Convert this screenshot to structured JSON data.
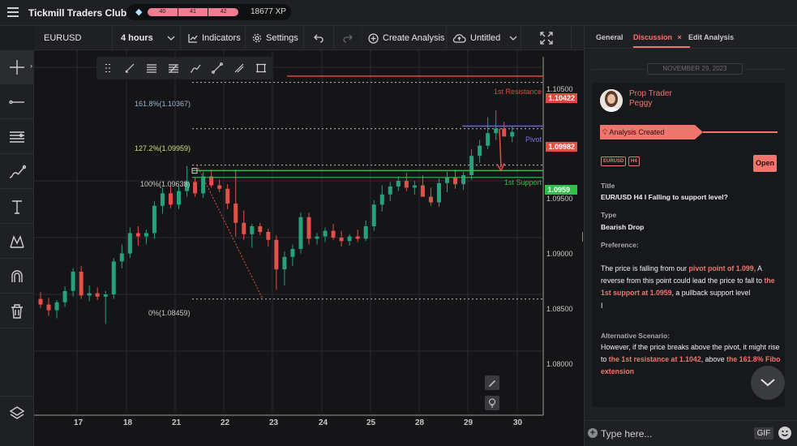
{
  "app": {
    "title": "Tickmill Traders Club",
    "xp_segments": [
      "40",
      "41",
      "42"
    ],
    "xp": "18677 XP"
  },
  "toolbar": {
    "symbol": "EURUSD",
    "timeframe": "4 hours",
    "indicators": "Indicators",
    "settings": "Settings",
    "create_analysis": "Create Analysis",
    "layout": "Untitled"
  },
  "left_tools": [
    "crosshair-icon",
    "horizontal-line-icon",
    "channel-icon",
    "brush-icon",
    "text-icon",
    "pattern-icon",
    "magnet-icon",
    "trash-icon",
    "layers-icon"
  ],
  "draw_tools": [
    "drag-handle-icon",
    "pencil-icon",
    "lines-icon",
    "fib-icon",
    "brush-icon",
    "ray-icon",
    "eraser-icon",
    "rectangle-icon"
  ],
  "chart_data": {
    "type": "candlestick",
    "symbol": "EURUSD",
    "timeframe": "4 hours",
    "y_ticks": [
      "1.10500",
      "1.09500",
      "1.09000",
      "1.08500",
      "1.08000"
    ],
    "x_ticks": [
      "17",
      "18",
      "21",
      "22",
      "23",
      "24",
      "25",
      "28",
      "29",
      "30"
    ],
    "ylim": [
      1.0765,
      1.1065
    ],
    "levels": [
      {
        "label": "1st Resistance",
        "value": 1.10422,
        "tag": "1.10422",
        "color": "#e2473f"
      },
      {
        "label": "Pivot",
        "value": 1.09982,
        "tag": "1.09982",
        "color": "#6b63d6"
      },
      {
        "label": "1st Support",
        "value": 1.0959,
        "tag": "1.0959",
        "color": "#2fbf4a"
      }
    ],
    "fib": [
      {
        "label": "161.8%(1.10367)",
        "value": 1.10367,
        "color": "#9ab4d4"
      },
      {
        "label": "127.2%(1.09959)",
        "value": 1.09959,
        "color": "#cfe07a"
      },
      {
        "label": "100%(1.09638)",
        "value": 1.09638,
        "color": "#c9c9c9"
      },
      {
        "label": "0%(1.08459)",
        "value": 1.08459,
        "color": "#c9c9c9"
      }
    ],
    "candles": [
      [
        1.0846,
        1.0852,
        1.0838,
        1.0841
      ],
      [
        1.0841,
        1.0847,
        1.0831,
        1.0836
      ],
      [
        1.0836,
        1.0845,
        1.0829,
        1.0843
      ],
      [
        1.0843,
        1.0857,
        1.0839,
        1.0853
      ],
      [
        1.0853,
        1.0873,
        1.0848,
        1.087
      ],
      [
        1.087,
        1.0875,
        1.0846,
        1.0849
      ],
      [
        1.0849,
        1.0858,
        1.0844,
        1.0851
      ],
      [
        1.0851,
        1.0856,
        1.0845,
        1.0848
      ],
      [
        1.0848,
        1.0853,
        1.0824,
        1.085
      ],
      [
        1.085,
        1.0882,
        1.0846,
        1.0879
      ],
      [
        1.0879,
        1.0894,
        1.0873,
        1.0886
      ],
      [
        1.0886,
        1.0909,
        1.0882,
        1.0904
      ],
      [
        1.0904,
        1.091,
        1.0893,
        1.0901
      ],
      [
        1.0901,
        1.0907,
        1.0894,
        1.0904
      ],
      [
        1.0904,
        1.0932,
        1.0899,
        1.0928
      ],
      [
        1.0928,
        1.0944,
        1.0921,
        1.0939
      ],
      [
        1.0939,
        1.0946,
        1.0926,
        1.0929
      ],
      [
        1.0929,
        1.0945,
        1.0925,
        1.0941
      ],
      [
        1.0941,
        1.0963,
        1.0936,
        1.0949
      ],
      [
        1.0949,
        1.0953,
        1.0936,
        1.0939
      ],
      [
        1.0939,
        1.0958,
        1.0935,
        1.0954
      ],
      [
        1.0954,
        1.096,
        1.0944,
        1.0946
      ],
      [
        1.0946,
        1.0951,
        1.094,
        1.0943
      ],
      [
        1.0943,
        1.0947,
        1.0925,
        1.093
      ],
      [
        1.093,
        1.096,
        1.0901,
        1.0913
      ],
      [
        1.0913,
        1.0924,
        1.0898,
        1.0903
      ],
      [
        1.0903,
        1.0912,
        1.0891,
        1.091
      ],
      [
        1.091,
        1.0913,
        1.0902,
        1.0905
      ],
      [
        1.0905,
        1.0908,
        1.0892,
        1.0898
      ],
      [
        1.0898,
        1.0902,
        1.0854,
        1.0872
      ],
      [
        1.0872,
        1.0888,
        1.0858,
        1.0883
      ],
      [
        1.0883,
        1.0894,
        1.0875,
        1.089
      ],
      [
        1.089,
        1.0922,
        1.0886,
        1.0918
      ],
      [
        1.0918,
        1.0922,
        1.0894,
        1.0899
      ],
      [
        1.0899,
        1.0904,
        1.0894,
        1.0901
      ],
      [
        1.0901,
        1.0909,
        1.0896,
        1.0906
      ],
      [
        1.0906,
        1.0912,
        1.0898,
        1.09
      ],
      [
        1.09,
        1.0906,
        1.0892,
        1.0897
      ],
      [
        1.0897,
        1.0903,
        1.0893,
        1.0901
      ],
      [
        1.0901,
        1.0907,
        1.0896,
        1.0899
      ],
      [
        1.0899,
        1.0915,
        1.0897,
        1.091
      ],
      [
        1.091,
        1.0933,
        1.0906,
        1.0929
      ],
      [
        1.0929,
        1.0946,
        1.0923,
        1.0938
      ],
      [
        1.0938,
        1.0949,
        1.0932,
        1.0945
      ],
      [
        1.0945,
        1.0954,
        1.0941,
        1.095
      ],
      [
        1.095,
        1.0957,
        1.0941,
        1.0944
      ],
      [
        1.0944,
        1.095,
        1.0938,
        1.0946
      ],
      [
        1.0946,
        1.0955,
        1.094,
        1.0936
      ],
      [
        1.0936,
        1.0944,
        1.0928,
        1.0931
      ],
      [
        1.0931,
        1.0952,
        1.0927,
        1.0948
      ],
      [
        1.0948,
        1.0958,
        1.094,
        1.0953
      ],
      [
        1.0953,
        1.096,
        1.0943,
        1.0947
      ],
      [
        1.0947,
        1.0958,
        1.0942,
        1.0955
      ],
      [
        1.0955,
        1.0978,
        1.0951,
        1.0972
      ],
      [
        1.0972,
        1.0986,
        1.0966,
        1.0981
      ],
      [
        1.0981,
        1.1006,
        1.0978,
        1.0992
      ],
      [
        1.0992,
        1.1012,
        1.0986,
        1.0996
      ],
      [
        1.0996,
        1.1002,
        1.099,
        1.0989
      ],
      [
        1.0989,
        1.0998,
        1.0984,
        1.0993
      ]
    ]
  },
  "panel": {
    "tabs": [
      "General",
      "Discussion",
      "Edit Analysis"
    ],
    "active_tab_close": "×",
    "date": "NOVEMBER 29, 2023",
    "author_role": "Prop Trader",
    "author_name": "Peggy",
    "status": "Analysis Created",
    "chips": [
      "EURUSD",
      "H4"
    ],
    "open_label": "Open",
    "title_label": "Title",
    "title_value": "EUR/USD H4 I Falling to support level?",
    "type_label": "Type",
    "type_value": "Bearish Drop",
    "pref_label": "Preference:",
    "pref_1": "The price is falling from our ",
    "pref_hl1": "pivot point of 1.099,",
    "pref_2": " A reverse from this point could lead the price to fall to ",
    "pref_hl2": "the 1st support at 1.0959",
    "pref_3": ", a pullback support level",
    "pref_caret": "I",
    "alt_label": "Alternative Scenario:",
    "alt_1": "However, if the price breaks above the pivot, it might rise to ",
    "alt_hl1": "the 1st resistance at 1.1042",
    "alt_2": ", above ",
    "alt_hl2": "the 161.8% Fibo extension",
    "input_placeholder": "Type here...",
    "gif_label": "GIF"
  },
  "colors": {
    "accent": "#f0766d",
    "bull": "#26a17a",
    "bear": "#e2504a",
    "resistance": "#e2473f",
    "pivot": "#6b63d6",
    "support": "#2fbf4a"
  }
}
